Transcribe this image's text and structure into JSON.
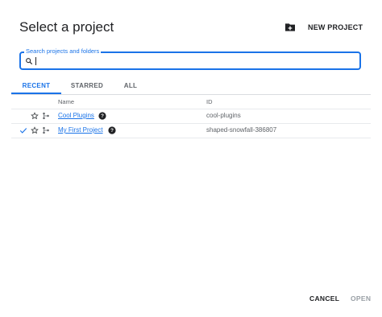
{
  "dialog": {
    "title": "Select a project"
  },
  "toolbar": {
    "new_project_label": "NEW PROJECT"
  },
  "search": {
    "label": "Search projects and folders",
    "value": "",
    "placeholder": ""
  },
  "tabs": [
    {
      "label": "RECENT",
      "active": true
    },
    {
      "label": "STARRED",
      "active": false
    },
    {
      "label": "ALL",
      "active": false
    }
  ],
  "table": {
    "columns": {
      "name": "Name",
      "id": "ID"
    },
    "rows": [
      {
        "name": "Cool Plugins",
        "id": "cool-plugins",
        "selected": false,
        "icons": [
          "star-icon",
          "project-hierarchy-icon",
          "help-icon"
        ]
      },
      {
        "name": "My First Project",
        "id": "shaped-snowfall-386807",
        "selected": true,
        "icons": [
          "check-icon",
          "star-icon",
          "project-hierarchy-icon",
          "help-icon"
        ]
      }
    ]
  },
  "footer": {
    "cancel_label": "CANCEL",
    "open_label": "OPEN"
  },
  "colors": {
    "accent": "#1a73e8",
    "text": "#202124",
    "muted": "#5f6368",
    "disabled": "#9aa0a6"
  },
  "icons": {
    "new_project": "add-folder-icon",
    "search": "search-icon"
  }
}
